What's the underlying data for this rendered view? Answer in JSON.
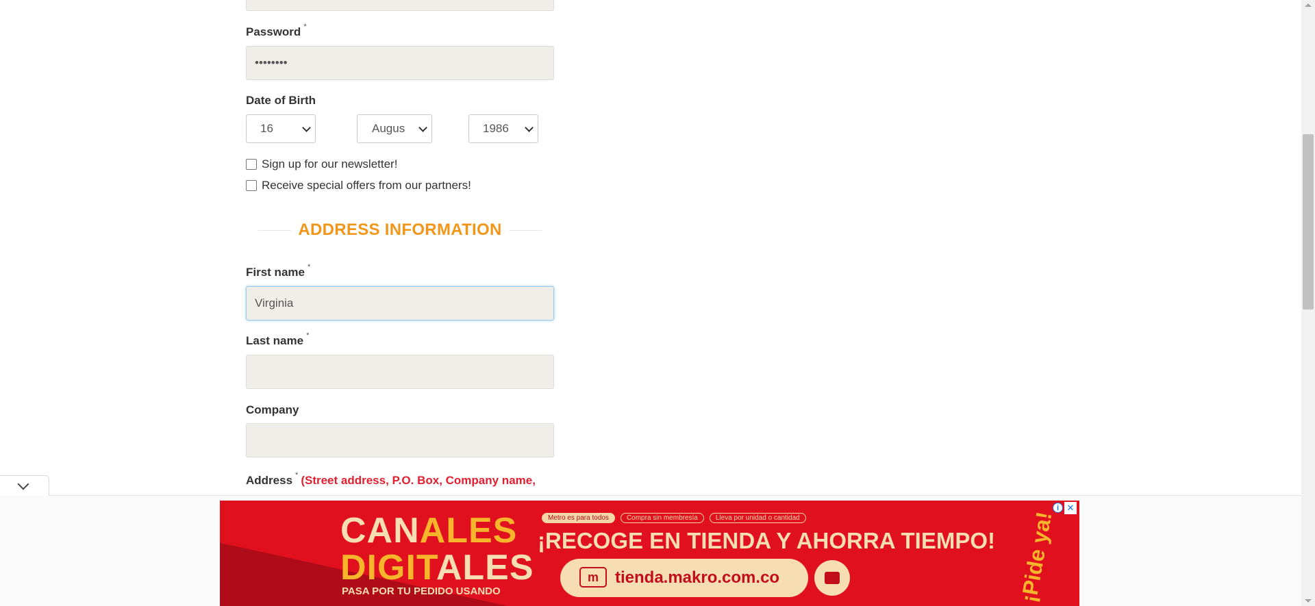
{
  "form": {
    "password": {
      "label": "Password",
      "required_mark": "*",
      "value": "••••••••"
    },
    "date_of_birth": {
      "label": "Date of Birth",
      "day": "16",
      "month": "Augus",
      "year": "1986"
    },
    "checkboxes": [
      {
        "label": "Sign up for our newsletter!",
        "checked": false
      },
      {
        "label": "Receive special offers from our partners!",
        "checked": false
      }
    ],
    "section_title": "ADDRESS INFORMATION",
    "first_name": {
      "label": "First name",
      "required_mark": "*",
      "value": "Virginia"
    },
    "last_name": {
      "label": "Last name",
      "required_mark": "*",
      "value": ""
    },
    "company": {
      "label": "Company",
      "value": ""
    },
    "address": {
      "label": "Address",
      "required_mark": "*",
      "note": "(Street address, P.O. Box, Company name,"
    }
  },
  "ad": {
    "brand_line1_a": "CAN",
    "brand_line1_b": "ALES",
    "brand_line2_a": "DIGIT",
    "brand_line2_b": "ALES",
    "tagline": "PASA POR TU PEDIDO USANDO",
    "pills": [
      "Metro es para todos",
      "Compra sin membresía",
      "Lleva por unidad o cantidad"
    ],
    "headline": "¡RECOGE EN TIENDA Y AHORRA TIEMPO!",
    "url": "tienda.makro.com.co",
    "url_icon": "m",
    "side_text": "¡Pide ya!",
    "info_symbol": "i",
    "close_symbol": "✕"
  },
  "colors": {
    "accent": "#f2961a",
    "address_note": "#e02030",
    "input_bg": "#efeee9",
    "ad_red": "#e1101e"
  }
}
